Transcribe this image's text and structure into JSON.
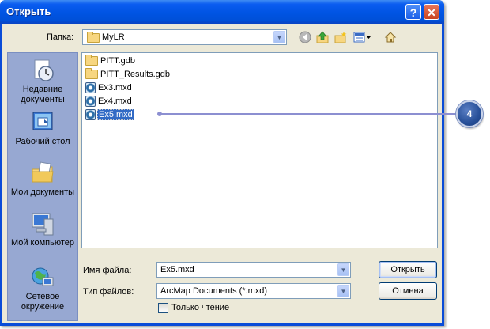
{
  "window": {
    "title": "Открыть"
  },
  "titlebar": {
    "help_glyph": "?",
    "close_glyph": "✕"
  },
  "lookin": {
    "label": "Папка:",
    "value": "MyLR"
  },
  "toolbar": {
    "icons": [
      "back-icon",
      "up-folder-icon",
      "new-folder-icon",
      "views-menu-icon",
      "tools-icon"
    ]
  },
  "places": [
    {
      "label": "Недавние документы",
      "icon": "recent-documents-icon"
    },
    {
      "label": "Рабочий стол",
      "icon": "desktop-icon"
    },
    {
      "label": "Мои документы",
      "icon": "my-documents-icon"
    },
    {
      "label": "Мой компьютер",
      "icon": "my-computer-icon"
    },
    {
      "label": "Сетевое окружение",
      "icon": "network-places-icon"
    }
  ],
  "files": [
    {
      "name": "PITT.gdb",
      "type": "folder",
      "selected": false
    },
    {
      "name": "PITT_Results.gdb",
      "type": "folder",
      "selected": false
    },
    {
      "name": "Ex3.mxd",
      "type": "mxd",
      "selected": false
    },
    {
      "name": "Ex4.mxd",
      "type": "mxd",
      "selected": false
    },
    {
      "name": "Ex5.mxd",
      "type": "mxd",
      "selected": true
    }
  ],
  "filename": {
    "label": "Имя файла:",
    "value": "Ex5.mxd"
  },
  "filetype": {
    "label": "Тип файлов:",
    "value": "ArcMap Documents (*.mxd)"
  },
  "readonly": {
    "label": "Только чтение",
    "checked": false
  },
  "buttons": {
    "open": "Открыть",
    "cancel": "Отмена"
  },
  "callout": {
    "number": "4"
  },
  "colors": {
    "titlebar": "#0054e3",
    "selection": "#316ac5",
    "places_bar": "#97a8d2",
    "callout": "#274f98"
  }
}
